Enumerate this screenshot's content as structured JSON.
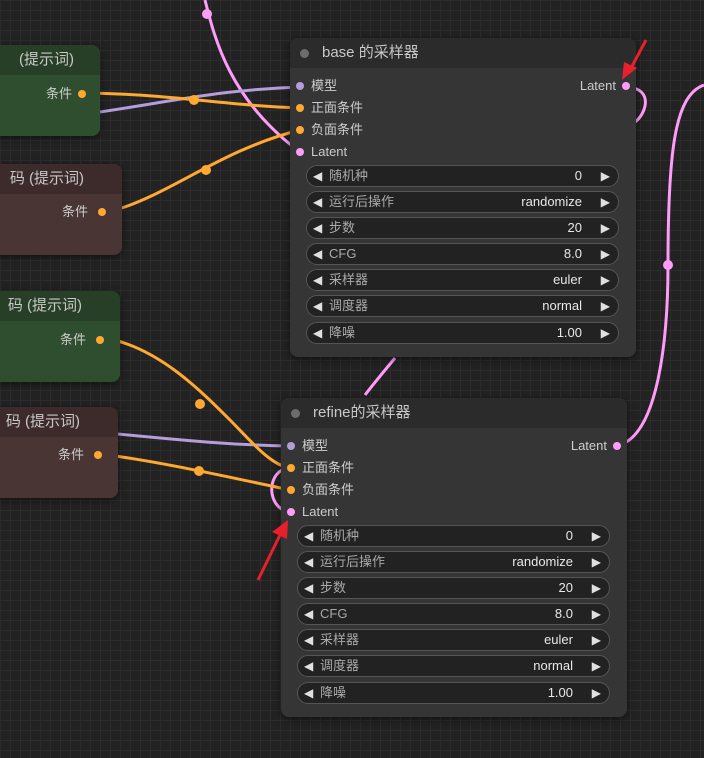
{
  "colors": {
    "model_wire": "#b39ddb",
    "cond_wire": "#ffa931",
    "latent_wire": "#ff9cf9",
    "annotation_arrow": "#e8202a"
  },
  "left_nodes": [
    {
      "title": "(提示词)",
      "output_label": "条件",
      "color": "green"
    },
    {
      "title": "码 (提示词)",
      "output_label": "条件",
      "color": "brown"
    },
    {
      "title": "码 (提示词)",
      "output_label": "条件",
      "color": "green"
    },
    {
      "title": "码 (提示词)",
      "output_label": "条件",
      "color": "brown"
    }
  ],
  "base_sampler": {
    "title": "base 的采样器",
    "inputs": [
      "模型",
      "正面条件",
      "负面条件",
      "Latent"
    ],
    "output": "Latent",
    "widgets": [
      {
        "label": "随机种",
        "value": "0"
      },
      {
        "label": "运行后操作",
        "value": "randomize"
      },
      {
        "label": "步数",
        "value": "20"
      },
      {
        "label": "CFG",
        "value": "8.0"
      },
      {
        "label": "采样器",
        "value": "euler"
      },
      {
        "label": "调度器",
        "value": "normal"
      },
      {
        "label": "降噪",
        "value": "1.00"
      }
    ]
  },
  "refine_sampler": {
    "title": "refine的采样器",
    "inputs": [
      "模型",
      "正面条件",
      "负面条件",
      "Latent"
    ],
    "output": "Latent",
    "widgets": [
      {
        "label": "随机种",
        "value": "0"
      },
      {
        "label": "运行后操作",
        "value": "randomize"
      },
      {
        "label": "步数",
        "value": "20"
      },
      {
        "label": "CFG",
        "value": "8.0"
      },
      {
        "label": "采样器",
        "value": "euler"
      },
      {
        "label": "调度器",
        "value": "normal"
      },
      {
        "label": "降噪",
        "value": "1.00"
      }
    ]
  },
  "icons": {
    "arrow_left": "◀",
    "arrow_right": "▶"
  }
}
